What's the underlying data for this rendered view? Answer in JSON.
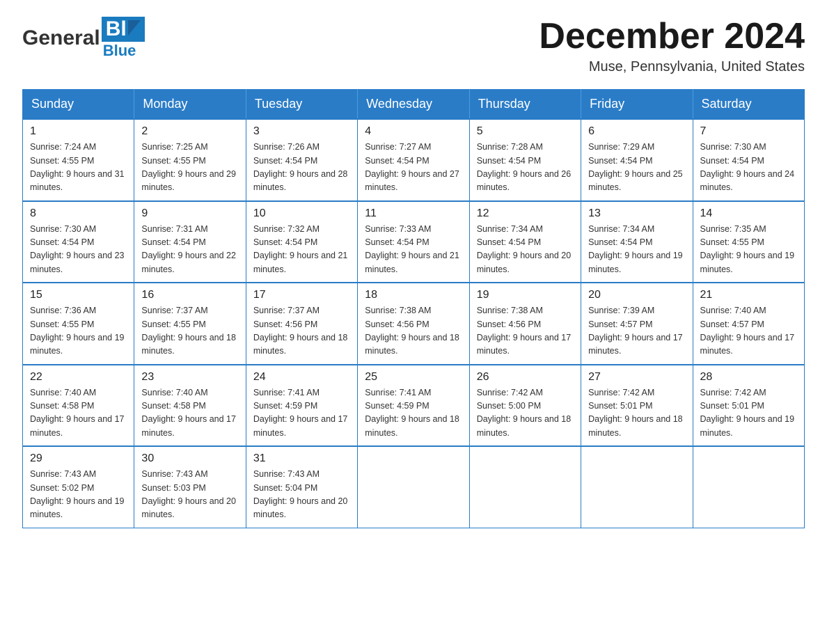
{
  "header": {
    "logo_general": "General",
    "logo_blue": "Blue",
    "month_title": "December 2024",
    "location": "Muse, Pennsylvania, United States"
  },
  "days_of_week": [
    "Sunday",
    "Monday",
    "Tuesday",
    "Wednesday",
    "Thursday",
    "Friday",
    "Saturday"
  ],
  "weeks": [
    [
      {
        "day": "1",
        "sunrise": "7:24 AM",
        "sunset": "4:55 PM",
        "daylight": "9 hours and 31 minutes."
      },
      {
        "day": "2",
        "sunrise": "7:25 AM",
        "sunset": "4:55 PM",
        "daylight": "9 hours and 29 minutes."
      },
      {
        "day": "3",
        "sunrise": "7:26 AM",
        "sunset": "4:54 PM",
        "daylight": "9 hours and 28 minutes."
      },
      {
        "day": "4",
        "sunrise": "7:27 AM",
        "sunset": "4:54 PM",
        "daylight": "9 hours and 27 minutes."
      },
      {
        "day": "5",
        "sunrise": "7:28 AM",
        "sunset": "4:54 PM",
        "daylight": "9 hours and 26 minutes."
      },
      {
        "day": "6",
        "sunrise": "7:29 AM",
        "sunset": "4:54 PM",
        "daylight": "9 hours and 25 minutes."
      },
      {
        "day": "7",
        "sunrise": "7:30 AM",
        "sunset": "4:54 PM",
        "daylight": "9 hours and 24 minutes."
      }
    ],
    [
      {
        "day": "8",
        "sunrise": "7:30 AM",
        "sunset": "4:54 PM",
        "daylight": "9 hours and 23 minutes."
      },
      {
        "day": "9",
        "sunrise": "7:31 AM",
        "sunset": "4:54 PM",
        "daylight": "9 hours and 22 minutes."
      },
      {
        "day": "10",
        "sunrise": "7:32 AM",
        "sunset": "4:54 PM",
        "daylight": "9 hours and 21 minutes."
      },
      {
        "day": "11",
        "sunrise": "7:33 AM",
        "sunset": "4:54 PM",
        "daylight": "9 hours and 21 minutes."
      },
      {
        "day": "12",
        "sunrise": "7:34 AM",
        "sunset": "4:54 PM",
        "daylight": "9 hours and 20 minutes."
      },
      {
        "day": "13",
        "sunrise": "7:34 AM",
        "sunset": "4:54 PM",
        "daylight": "9 hours and 19 minutes."
      },
      {
        "day": "14",
        "sunrise": "7:35 AM",
        "sunset": "4:55 PM",
        "daylight": "9 hours and 19 minutes."
      }
    ],
    [
      {
        "day": "15",
        "sunrise": "7:36 AM",
        "sunset": "4:55 PM",
        "daylight": "9 hours and 19 minutes."
      },
      {
        "day": "16",
        "sunrise": "7:37 AM",
        "sunset": "4:55 PM",
        "daylight": "9 hours and 18 minutes."
      },
      {
        "day": "17",
        "sunrise": "7:37 AM",
        "sunset": "4:56 PM",
        "daylight": "9 hours and 18 minutes."
      },
      {
        "day": "18",
        "sunrise": "7:38 AM",
        "sunset": "4:56 PM",
        "daylight": "9 hours and 18 minutes."
      },
      {
        "day": "19",
        "sunrise": "7:38 AM",
        "sunset": "4:56 PM",
        "daylight": "9 hours and 17 minutes."
      },
      {
        "day": "20",
        "sunrise": "7:39 AM",
        "sunset": "4:57 PM",
        "daylight": "9 hours and 17 minutes."
      },
      {
        "day": "21",
        "sunrise": "7:40 AM",
        "sunset": "4:57 PM",
        "daylight": "9 hours and 17 minutes."
      }
    ],
    [
      {
        "day": "22",
        "sunrise": "7:40 AM",
        "sunset": "4:58 PM",
        "daylight": "9 hours and 17 minutes."
      },
      {
        "day": "23",
        "sunrise": "7:40 AM",
        "sunset": "4:58 PM",
        "daylight": "9 hours and 17 minutes."
      },
      {
        "day": "24",
        "sunrise": "7:41 AM",
        "sunset": "4:59 PM",
        "daylight": "9 hours and 17 minutes."
      },
      {
        "day": "25",
        "sunrise": "7:41 AM",
        "sunset": "4:59 PM",
        "daylight": "9 hours and 18 minutes."
      },
      {
        "day": "26",
        "sunrise": "7:42 AM",
        "sunset": "5:00 PM",
        "daylight": "9 hours and 18 minutes."
      },
      {
        "day": "27",
        "sunrise": "7:42 AM",
        "sunset": "5:01 PM",
        "daylight": "9 hours and 18 minutes."
      },
      {
        "day": "28",
        "sunrise": "7:42 AM",
        "sunset": "5:01 PM",
        "daylight": "9 hours and 19 minutes."
      }
    ],
    [
      {
        "day": "29",
        "sunrise": "7:43 AM",
        "sunset": "5:02 PM",
        "daylight": "9 hours and 19 minutes."
      },
      {
        "day": "30",
        "sunrise": "7:43 AM",
        "sunset": "5:03 PM",
        "daylight": "9 hours and 20 minutes."
      },
      {
        "day": "31",
        "sunrise": "7:43 AM",
        "sunset": "5:04 PM",
        "daylight": "9 hours and 20 minutes."
      },
      null,
      null,
      null,
      null
    ]
  ],
  "labels": {
    "sunrise_prefix": "Sunrise: ",
    "sunset_prefix": "Sunset: ",
    "daylight_prefix": "Daylight: "
  }
}
